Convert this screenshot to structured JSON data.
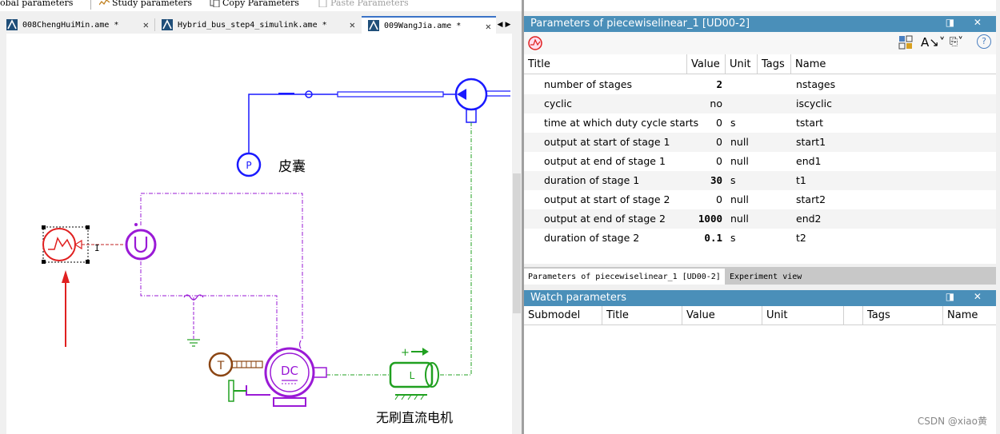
{
  "toolbar": {
    "global_params": "obal parameters",
    "study_params": "Study parameters",
    "copy_params": "Copy Parameters",
    "paste_params": "Paste Parameters"
  },
  "tabs": [
    {
      "label": "008ChengHuiMin.ame *"
    },
    {
      "label": "Hybrid_bus_step4_simulink.ame *"
    },
    {
      "label": "009WangJia.ame *"
    }
  ],
  "canvas": {
    "label_bladder": "皮囊",
    "label_motor": "无刷直流电机",
    "pressure_symbol": "P",
    "temp_symbol": "T",
    "dc_symbol": "DC",
    "cursor_mark": "I",
    "inductor_symbol": "L"
  },
  "params_panel": {
    "title": "Parameters of piecewiselinear_1 [UD00-2]",
    "columns": [
      "Title",
      "Value",
      "Unit",
      "Tags",
      "Name"
    ],
    "rows": [
      {
        "title": "number of stages",
        "value": "2",
        "unit": "",
        "name": "nstages",
        "bold": true
      },
      {
        "title": "cyclic",
        "value": "no",
        "unit": "",
        "name": "iscyclic",
        "bold": false
      },
      {
        "title": "time at which duty cycle starts",
        "value": "0",
        "unit": "s",
        "name": "tstart",
        "bold": false
      },
      {
        "title": "output at start of stage 1",
        "value": "0",
        "unit": "null",
        "name": "start1",
        "bold": false
      },
      {
        "title": "output at end of stage 1",
        "value": "0",
        "unit": "null",
        "name": "end1",
        "bold": false
      },
      {
        "title": "duration of stage 1",
        "value": "30",
        "unit": "s",
        "name": "t1",
        "bold": true
      },
      {
        "title": "output at start of stage 2",
        "value": "0",
        "unit": "null",
        "name": "start2",
        "bold": false
      },
      {
        "title": "output at end of stage 2",
        "value": "1000",
        "unit": "null",
        "name": "end2",
        "bold": true
      },
      {
        "title": "duration of stage 2",
        "value": "0.1",
        "unit": "s",
        "name": "t2",
        "bold": true
      }
    ],
    "bottom_tabs": [
      "Parameters of piecewiselinear_1 [UD00-2]",
      "Experiment view"
    ]
  },
  "watch_panel": {
    "title": "Watch parameters",
    "columns": [
      "Submodel",
      "Title",
      "Value",
      "Unit",
      "",
      "Tags",
      "Name"
    ]
  },
  "panel_buttons": "◨ ✕",
  "watermark": "CSDN @xiao黄",
  "colors": {
    "panel_header": "#4a8fb9",
    "hydraulic": "#1a1aff",
    "electric": "#9a1ad6",
    "signal": "#e02020",
    "mechanical": "#20a020"
  }
}
